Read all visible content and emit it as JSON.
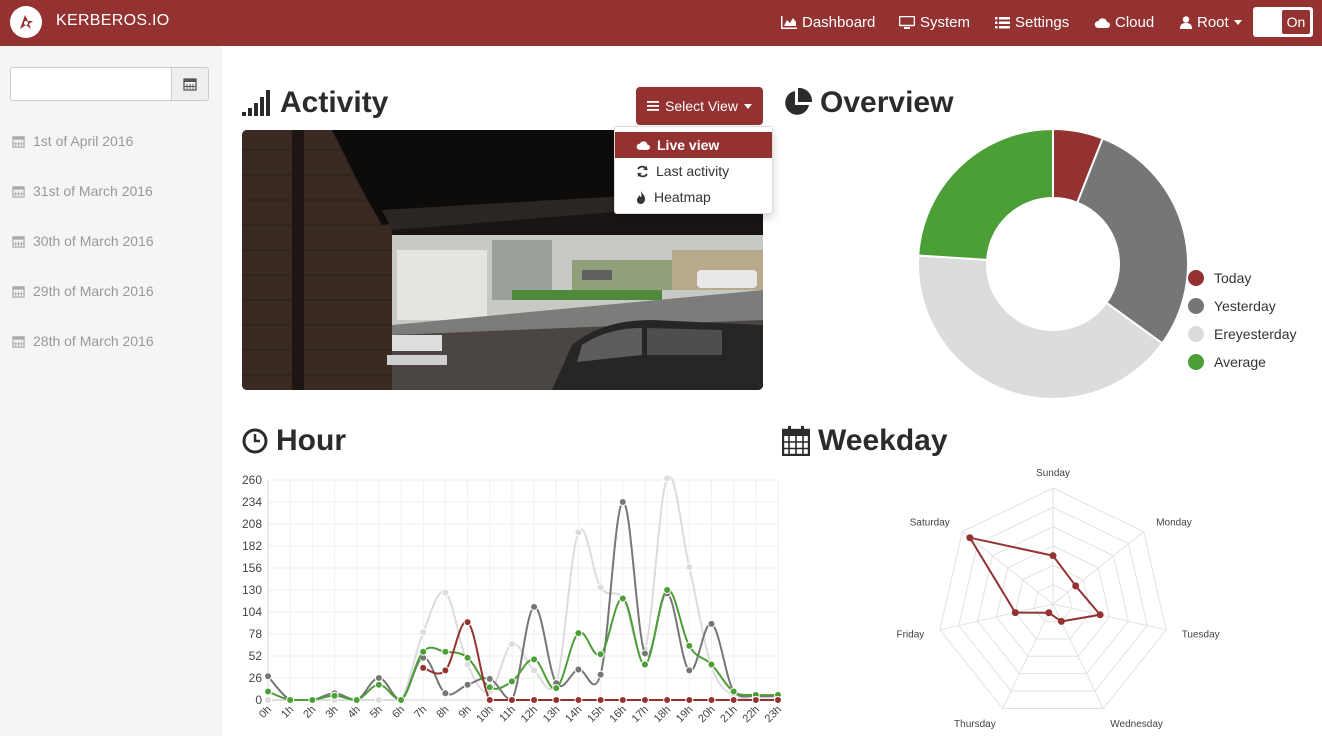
{
  "navbar": {
    "brand": "KERBEROS.IO",
    "items": [
      {
        "label": "Dashboard",
        "icon": "chart-area-icon"
      },
      {
        "label": "System",
        "icon": "monitor-icon"
      },
      {
        "label": "Settings",
        "icon": "list-icon"
      },
      {
        "label": "Cloud",
        "icon": "cloud-icon"
      },
      {
        "label": "Root",
        "icon": "user-icon"
      }
    ],
    "toggle_label": "On"
  },
  "sidebar": {
    "date_input_value": "",
    "dates": [
      "1st of April 2016",
      "31st of March 2016",
      "30th of March 2016",
      "29th of March 2016",
      "28th of March 2016"
    ]
  },
  "activity": {
    "title": "Activity",
    "select_view_label": "Select View",
    "menu": [
      {
        "label": "Live view",
        "icon": "cloud-icon",
        "active": true
      },
      {
        "label": "Last activity",
        "icon": "refresh-icon",
        "active": false
      },
      {
        "label": "Heatmap",
        "icon": "fire-icon",
        "active": false
      }
    ]
  },
  "overview": {
    "title": "Overview",
    "legend": [
      {
        "label": "Today",
        "color": "#943232"
      },
      {
        "label": "Yesterday",
        "color": "#767676"
      },
      {
        "label": "Ereyesterday",
        "color": "#dcdcdc"
      },
      {
        "label": "Average",
        "color": "#4c9e37"
      }
    ]
  },
  "hour": {
    "title": "Hour"
  },
  "weekday": {
    "title": "Weekday"
  },
  "colors": {
    "brand": "#943232",
    "yesterday": "#767676",
    "ereyesterday": "#dcdcdc",
    "average": "#4c9e37"
  },
  "chart_data": [
    {
      "type": "pie",
      "chart": "overview",
      "categories": [
        "Today",
        "Yesterday",
        "Ereyesterday",
        "Average"
      ],
      "values": [
        6,
        29,
        41,
        24
      ]
    },
    {
      "type": "line",
      "chart": "hour",
      "categories": [
        "0h",
        "1h",
        "2h",
        "3h",
        "4h",
        "5h",
        "6h",
        "7h",
        "8h",
        "9h",
        "10h",
        "11h",
        "12h",
        "13h",
        "14h",
        "15h",
        "16h",
        "17h",
        "18h",
        "19h",
        "20h",
        "21h",
        "22h",
        "23h"
      ],
      "yticks": [
        0,
        26,
        52,
        78,
        104,
        130,
        156,
        182,
        208,
        234,
        260
      ],
      "ylim": [
        0,
        260
      ],
      "grid": true,
      "series": [
        {
          "name": "Today",
          "values": [
            null,
            null,
            null,
            null,
            null,
            null,
            null,
            38,
            35,
            92,
            0,
            0,
            0,
            0,
            0,
            0,
            0,
            0,
            0,
            0,
            0,
            0,
            0,
            0
          ]
        },
        {
          "name": "Yesterday",
          "values": [
            28,
            0,
            0,
            8,
            0,
            26,
            0,
            50,
            8,
            18,
            25,
            0,
            110,
            20,
            36,
            30,
            234,
            55,
            126,
            35,
            90,
            10,
            5,
            5
          ]
        },
        {
          "name": "Ereyesterday",
          "values": [
            0,
            0,
            0,
            0,
            0,
            0,
            0,
            80,
            127,
            42,
            10,
            66,
            35,
            20,
            198,
            133,
            120,
            60,
            262,
            157,
            40,
            5,
            3,
            3
          ]
        },
        {
          "name": "Average",
          "values": [
            10,
            0,
            0,
            5,
            0,
            18,
            0,
            57,
            57,
            50,
            15,
            22,
            48,
            14,
            79,
            54,
            120,
            42,
            130,
            64,
            42,
            10,
            6,
            6
          ]
        }
      ]
    },
    {
      "type": "radar",
      "chart": "weekday",
      "categories": [
        "Sunday",
        "Monday",
        "Tuesday",
        "Wednesday",
        "Thursday",
        "Friday",
        "Saturday"
      ],
      "rmax": 12,
      "series": [
        {
          "name": "Today",
          "values": [
            5,
            3,
            5,
            2,
            1,
            4,
            11
          ]
        }
      ]
    }
  ]
}
